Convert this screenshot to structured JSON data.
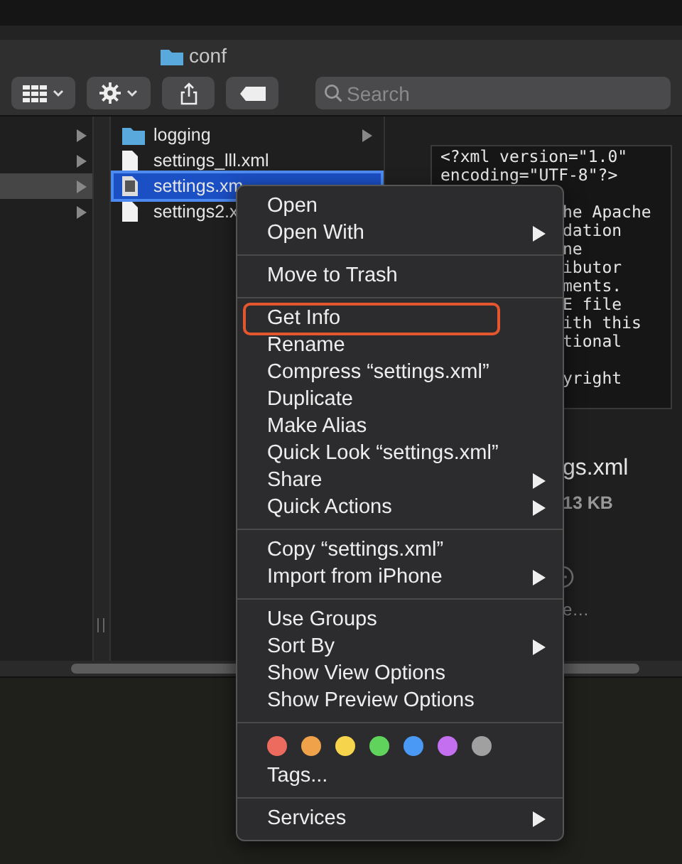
{
  "window": {
    "title": "conf"
  },
  "toolbar": {
    "search": {
      "placeholder": "Search"
    }
  },
  "sidebar_column": {
    "rows": [
      {
        "selected": false
      },
      {
        "selected": false
      },
      {
        "selected": true
      },
      {
        "selected": false
      }
    ]
  },
  "file_column": {
    "rows": [
      {
        "kind": "folder",
        "name": "logging",
        "selected": false,
        "has_children": true
      },
      {
        "kind": "file",
        "name": "settings_lll.xml",
        "selected": false
      },
      {
        "kind": "xml",
        "name": "settings.xm",
        "selected": true
      },
      {
        "kind": "file",
        "name": "settings2.x",
        "selected": false
      }
    ]
  },
  "preview": {
    "code_lines": [
      "<?xml version=\"1.0\"",
      "encoding=\"UTF-8\"?>"
    ],
    "code_fragment_blocks": [
      [
        "he Apache",
        "dation",
        "ne",
        "ibutor",
        "ments.",
        "E file",
        "ith this",
        "tional"
      ],
      [
        "yright"
      ]
    ],
    "file_name": "gs.xml",
    "file_size": "13 KB",
    "more_label": "e…"
  },
  "context_menu": [
    {
      "kind": "item",
      "label": "Open",
      "submenu": false,
      "outlined": false
    },
    {
      "kind": "item",
      "label": "Open With",
      "submenu": true,
      "outlined": false
    },
    {
      "kind": "separator"
    },
    {
      "kind": "item",
      "label": "Move to Trash",
      "submenu": false,
      "outlined": false
    },
    {
      "kind": "separator"
    },
    {
      "kind": "item",
      "label": "Get Info",
      "submenu": false,
      "outlined": true
    },
    {
      "kind": "item",
      "label": "Rename",
      "submenu": false,
      "outlined": false
    },
    {
      "kind": "item",
      "label": "Compress “settings.xml”",
      "submenu": false,
      "outlined": false
    },
    {
      "kind": "item",
      "label": "Duplicate",
      "submenu": false,
      "outlined": false
    },
    {
      "kind": "item",
      "label": "Make Alias",
      "submenu": false,
      "outlined": false
    },
    {
      "kind": "item",
      "label": "Quick Look “settings.xml”",
      "submenu": false,
      "outlined": false
    },
    {
      "kind": "item",
      "label": "Share",
      "submenu": true,
      "outlined": false
    },
    {
      "kind": "item",
      "label": "Quick Actions",
      "submenu": true,
      "outlined": false
    },
    {
      "kind": "separator"
    },
    {
      "kind": "item",
      "label": "Copy “settings.xml”",
      "submenu": false,
      "outlined": false
    },
    {
      "kind": "item",
      "label": "Import from iPhone",
      "submenu": true,
      "outlined": false
    },
    {
      "kind": "separator"
    },
    {
      "kind": "item",
      "label": "Use Groups",
      "submenu": false,
      "outlined": false
    },
    {
      "kind": "item",
      "label": "Sort By",
      "submenu": true,
      "outlined": false
    },
    {
      "kind": "item",
      "label": "Show View Options",
      "submenu": false,
      "outlined": false
    },
    {
      "kind": "item",
      "label": "Show Preview Options",
      "submenu": false,
      "outlined": false
    },
    {
      "kind": "separator"
    },
    {
      "kind": "tags",
      "dots": [
        {
          "color": "#ec6a5e"
        },
        {
          "color": "#f0a24a"
        },
        {
          "color": "#f6d54c"
        },
        {
          "color": "#5fd35b"
        },
        {
          "color": "#4a9af5"
        },
        {
          "color": "#c46ef0"
        },
        {
          "color": "#a0a0a0"
        }
      ]
    },
    {
      "kind": "item",
      "label": "Tags...",
      "submenu": false,
      "outlined": false
    },
    {
      "kind": "separator"
    },
    {
      "kind": "item",
      "label": "Services",
      "submenu": true,
      "outlined": false
    }
  ]
}
